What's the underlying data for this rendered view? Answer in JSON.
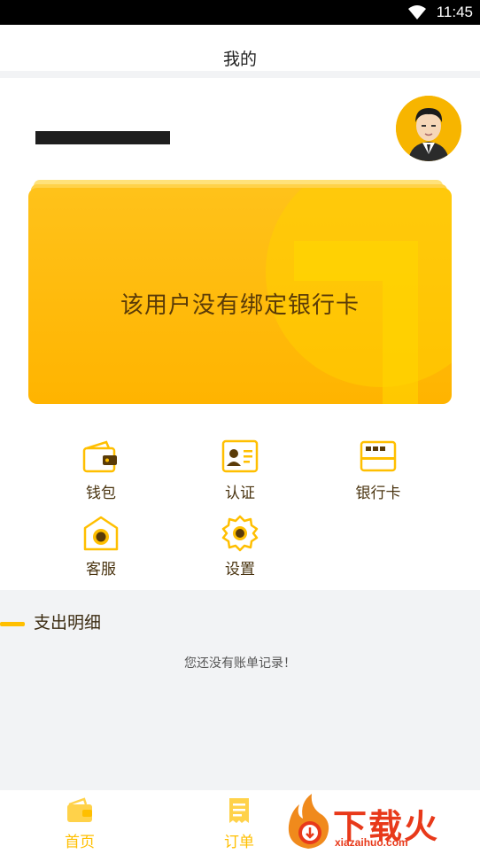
{
  "status_bar": {
    "time": "11:45"
  },
  "header": {
    "title": "我的"
  },
  "profile": {
    "avatar": "avatar-icon"
  },
  "bank_card": {
    "message": "该用户没有绑定银行卡",
    "color": "#ffb400"
  },
  "menu": {
    "items": [
      {
        "label": "钱包",
        "icon": "wallet-icon"
      },
      {
        "label": "认证",
        "icon": "id-card-icon"
      },
      {
        "label": "银行卡",
        "icon": "bank-card-icon"
      },
      {
        "label": "客服",
        "icon": "customer-service-icon"
      },
      {
        "label": "设置",
        "icon": "settings-icon"
      }
    ]
  },
  "expenses": {
    "title": "支出明细",
    "empty_text": "您还没有账单记录！"
  },
  "tabbar": {
    "items": [
      {
        "label": "首页",
        "icon": "home-icon"
      },
      {
        "label": "订单",
        "icon": "order-icon"
      }
    ]
  },
  "watermark": {
    "text": "下载火",
    "subtext": "xiazaihuo.com"
  },
  "colors": {
    "accent": "#ffbf00",
    "brown": "#5a3b08",
    "watermark": "#e8391a"
  }
}
